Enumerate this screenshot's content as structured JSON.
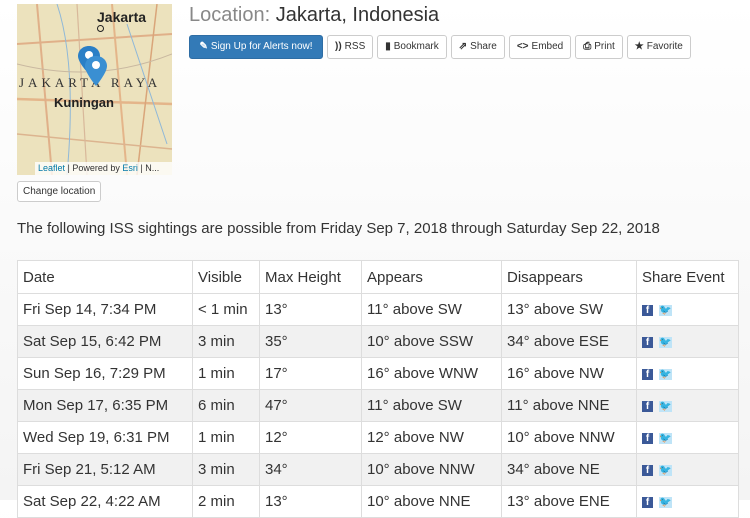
{
  "map": {
    "labels": {
      "city": "Jakarta",
      "region": "JAKARTA RAYA",
      "district": "Kuningan"
    },
    "attribution": {
      "leaflet": "Leaflet",
      "separator1": " | Powered by ",
      "esri": "Esri",
      "rest": " | N..."
    },
    "change_location_label": "Change location"
  },
  "header": {
    "title_label": "Location:",
    "title_value": " Jakarta, Indonesia"
  },
  "toolbar": {
    "buttons": [
      {
        "label": "Sign Up for Alerts now!",
        "icon": "edit-icon"
      },
      {
        "label": "RSS",
        "icon": "rss-icon"
      },
      {
        "label": "Bookmark",
        "icon": "bookmark-icon"
      },
      {
        "label": "Share",
        "icon": "share-icon"
      },
      {
        "label": "Embed",
        "icon": "code-icon"
      },
      {
        "label": "Print",
        "icon": "print-icon"
      },
      {
        "label": "Favorite",
        "icon": "star-icon"
      }
    ],
    "primary_color": "#337ab7"
  },
  "intro_text": "The following ISS sightings are possible from Friday Sep 7, 2018 through Saturday Sep 22, 2018",
  "table": {
    "headers": [
      "Date",
      "Visible",
      "Max Height",
      "Appears",
      "Disappears",
      "Share Event"
    ],
    "rows": [
      [
        "Fri Sep 14, 7:34 PM",
        "< 1 min",
        "13°",
        "11° above SW",
        "13° above SW"
      ],
      [
        "Sat Sep 15, 6:42 PM",
        "3 min",
        "35°",
        "10° above SSW",
        "34° above ESE"
      ],
      [
        "Sun Sep 16, 7:29 PM",
        "1 min",
        "17°",
        "16° above WNW",
        "16° above NW"
      ],
      [
        "Mon Sep 17, 6:35 PM",
        "6 min",
        "47°",
        "11° above SW",
        "11° above NNE"
      ],
      [
        "Wed Sep 19, 6:31 PM",
        "1 min",
        "12°",
        "12° above NW",
        "10° above NNW"
      ],
      [
        "Fri Sep 21, 5:12 AM",
        "3 min",
        "34°",
        "10° above NNW",
        "34° above NE"
      ],
      [
        "Sat Sep 22, 4:22 AM",
        "2 min",
        "13°",
        "10° above NNE",
        "13° above ENE"
      ]
    ],
    "share_icons": {
      "facebook": "f",
      "twitter": "t"
    }
  }
}
